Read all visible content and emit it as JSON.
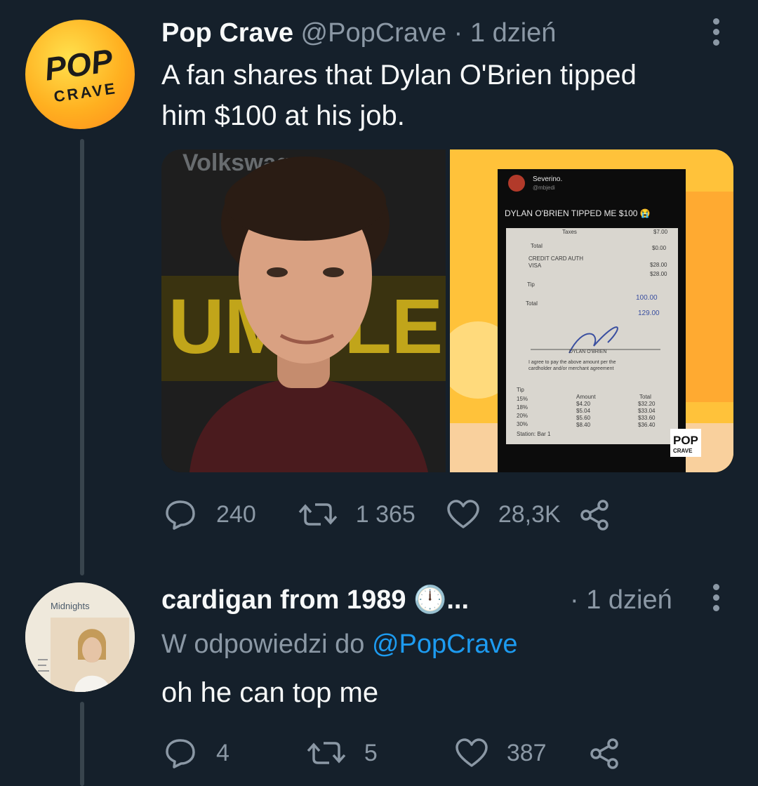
{
  "tweet1": {
    "display_name": "Pop Crave",
    "handle": "@PopCrave",
    "separator": "·",
    "time": "1 dzień",
    "text_line1": "A fan shares that Dylan O'Brien tipped",
    "text_line2": "him $100 at his job.",
    "avatar_logo_top": "POP",
    "avatar_logo_bottom": "CRAVE",
    "media": {
      "left_bg_text": "UMBLEBE",
      "left_top_text": "Volkswag",
      "screenshot_name": "Severino.",
      "screenshot_handle": "@mbjedi",
      "screenshot_text": "DYLAN O'BRIEN TIPPED ME $100 😭",
      "receipt": {
        "taxes": "Taxes",
        "taxes_value": "$7.00",
        "total_label": "Total",
        "total_value": "$0.00",
        "credit_line1": "CREDIT CARD AUTH",
        "credit_line2": "VISA",
        "credit_value": "$28.00",
        "credit_value2": "$28.00",
        "tip_label": "Tip",
        "tip_value": "100.00",
        "total2_label": "Total",
        "total2_value": "129.00",
        "signature_name": "DYLAN O'BRIEN",
        "agree_line1": "I agree to pay the above amount per the",
        "agree_line2": "cardholder and/or merchant agreement",
        "tip_table_headers": [
          "Tip",
          "Amount",
          "Total"
        ],
        "tip_rows": [
          [
            "15%",
            "$4.20",
            "$32.20"
          ],
          [
            "18%",
            "$5.04",
            "$33.04"
          ],
          [
            "20%",
            "$5.60",
            "$33.60"
          ],
          [
            "30%",
            "$8.40",
            "$36.40"
          ]
        ],
        "station": "Station: Bar 1"
      },
      "watermark_top": "POP",
      "watermark_bottom": "CRAVE"
    },
    "replies": "240",
    "retweets": "1 365",
    "likes": "28,3K"
  },
  "tweet2": {
    "display_name": "cardigan from 1989",
    "emoji": "🕛",
    "ellipsis": "...",
    "separator": "·",
    "time": "1 dzień",
    "reply_prefix": "W odpowiedzi do",
    "reply_to": "@PopCrave",
    "text": "oh he can top me",
    "avatar_album_title": "Midnights",
    "replies": "4",
    "retweets": "5",
    "likes": "387"
  },
  "colors": {
    "background": "#15202b",
    "text": "#f7f9f9",
    "muted": "#8b98a5",
    "link": "#1d9bf0",
    "thread_line": "#38444d"
  },
  "icons": [
    "reply-icon",
    "retweet-icon",
    "like-icon",
    "share-icon",
    "more-icon"
  ]
}
